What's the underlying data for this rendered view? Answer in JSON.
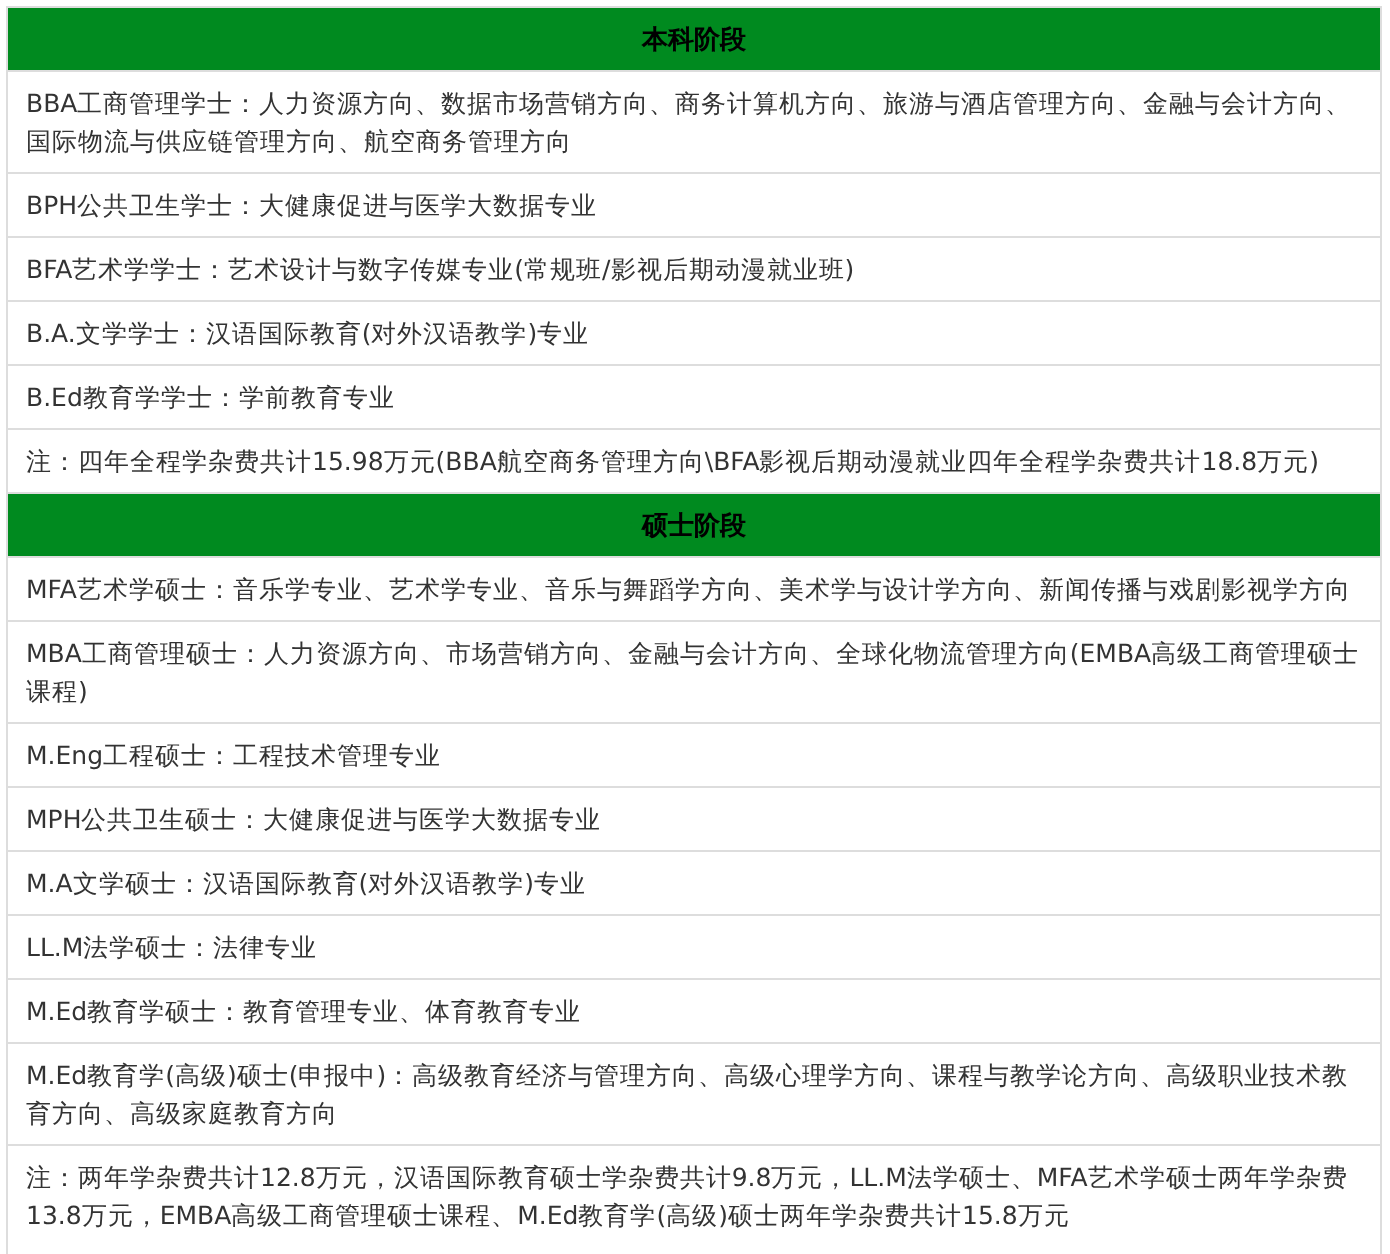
{
  "table": {
    "sections": [
      {
        "title": "本科阶段",
        "rows": [
          "BBA工商管理学士：人力资源方向、数据市场营销方向、商务计算机方向、旅游与酒店管理方向、金融与会计方向、国际物流与供应链管理方向、航空商务管理方向",
          "BPH公共卫生学士：大健康促进与医学大数据专业",
          "BFA艺术学学士：艺术设计与数字传媒专业(常规班/影视后期动漫就业班)",
          "B.A.文学学士：汉语国际教育(对外汉语教学)专业",
          "B.Ed教育学学士：学前教育专业",
          "注：四年全程学杂费共计15.98万元(BBA航空商务管理方向\\BFA影视后期动漫就业四年全程学杂费共计18.8万元)"
        ]
      },
      {
        "title": "硕士阶段",
        "rows": [
          "MFA艺术学硕士：音乐学专业、艺术学专业、音乐与舞蹈学方向、美术学与设计学方向、新闻传播与戏剧影视学方向",
          "MBA工商管理硕士：人力资源方向、市场营销方向、金融与会计方向、全球化物流管理方向(EMBA高级工商管理硕士课程)",
          "M.Eng工程硕士：工程技术管理专业",
          "MPH公共卫生硕士：大健康促进与医学大数据专业",
          "M.A文学硕士：汉语国际教育(对外汉语教学)专业",
          "LL.M法学硕士：法律专业",
          "M.Ed教育学硕士：教育管理专业、体育教育专业",
          "M.Ed教育学(高级)硕士(申报中)：高级教育经济与管理方向、高级心理学方向、课程与教学论方向、高级职业技术教育方向、高级家庭教育方向",
          "注：两年学杂费共计12.8万元，汉语国际教育硕士学杂费共计9.8万元，LL.M法学硕士、MFA艺术学硕士两年学杂费13.8万元，EMBA高级工商管理硕士课程、M.Ed教育学(高级)硕士两年学杂费共计15.8万元"
        ]
      }
    ]
  }
}
